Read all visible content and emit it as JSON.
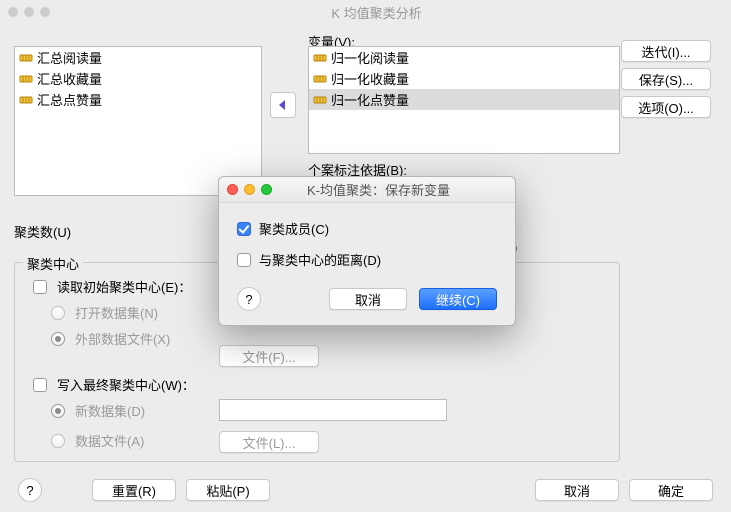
{
  "window": {
    "title": "K 均值聚类分析"
  },
  "sidebar": {
    "iterate": "迭代(I)...",
    "save": "保存(S)...",
    "options": "选项(O)..."
  },
  "vars": {
    "label": "变量(V):",
    "left_items": [
      "汇总阅读量",
      "汇总收藏量",
      "汇总点赞量"
    ],
    "right_items": [
      "归一化阅读量",
      "归一化收藏量",
      "归一化点赞量"
    ],
    "right_selected_index": 2
  },
  "case_label": "个案标注依据(B):",
  "cluster_count": {
    "label": "聚类数(U)"
  },
  "method": {
    "option_y_fragment": "(Y)"
  },
  "center": {
    "legend": "聚类中心",
    "read_initial": "读取初始聚类中心(E)：",
    "open_dataset": "打开数据集(N)",
    "external_file": "外部数据文件(X)",
    "file_btn": "文件(F)...",
    "write_final": "写入最终聚类中心(W)：",
    "new_dataset": "新数据集(D)",
    "data_file": "数据文件(A)",
    "file_btn2": "文件(L)..."
  },
  "bottom": {
    "help": "?",
    "reset": "重置(R)",
    "paste": "粘贴(P)",
    "cancel": "取消",
    "ok": "确定"
  },
  "modal": {
    "title": "K-均值聚类：保存新变量",
    "cluster_member": "聚类成员(C)",
    "distance": "与聚类中心的距离(D)",
    "help": "?",
    "cancel": "取消",
    "continue": "继续(C)"
  }
}
